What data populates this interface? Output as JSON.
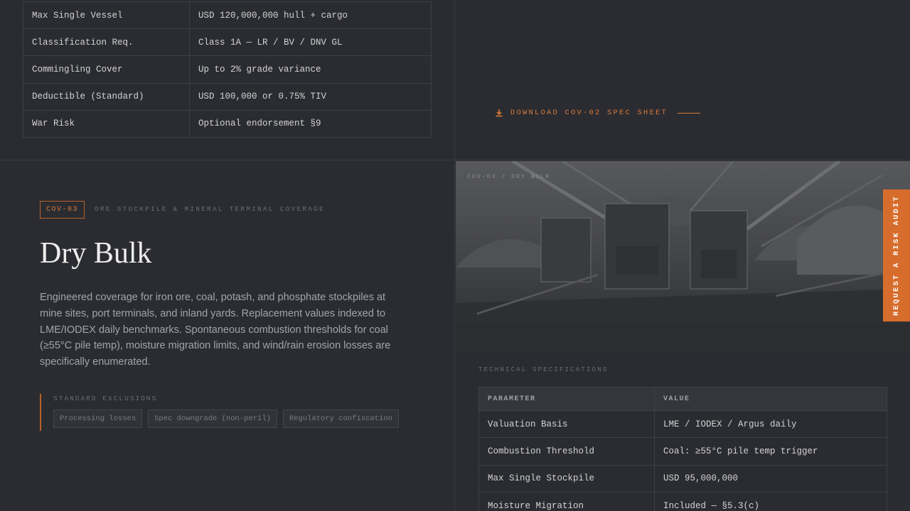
{
  "prev_section": {
    "rows": [
      {
        "param": "Max Single Vessel",
        "value": "USD 120,000,000 hull + cargo"
      },
      {
        "param": "Classification Req.",
        "value": "Class 1A — LR / BV / DNV GL"
      },
      {
        "param": "Commingling Cover",
        "value": "Up to 2% grade variance"
      },
      {
        "param": "Deductible (Standard)",
        "value": "USD 100,000 or 0.75% TIV"
      },
      {
        "param": "War Risk",
        "value": "Optional endorsement §9"
      }
    ],
    "download_label": "DOWNLOAD COV-02 SPEC SHEET",
    "download_icon": "download-arrow-icon"
  },
  "section": {
    "code": "COV-03",
    "kicker": "ORE STOCKPILE & MINERAL TERMINAL COVERAGE",
    "title": "Dry Bulk",
    "description": "Engineered coverage for iron ore, coal, potash, and phosphate stockpiles at mine sites, port terminals, and inland yards. Replacement values indexed to LME/IODEX daily benchmarks. Spontaneous combustion thresholds for coal (≥55°C pile temp), moisture migration limits, and wind/rain erosion losses are specifically enumerated.",
    "exclusions_label": "STANDARD EXCLUSIONS",
    "exclusions": [
      "Processing losses",
      "Spec downgrade (non-peril)",
      "Regulatory confiscation"
    ],
    "photo_tag": "COV-03 / DRY BULK",
    "tech_label": "TECHNICAL SPECIFICATIONS",
    "tech_headers": {
      "param": "PARAMETER",
      "value": "VALUE"
    },
    "tech_rows": [
      {
        "param": "Valuation Basis",
        "value": "LME / IODEX / Argus daily"
      },
      {
        "param": "Combustion Threshold",
        "value": "Coal: ≥55°C pile temp trigger"
      },
      {
        "param": "Max Single Stockpile",
        "value": "USD 95,000,000"
      },
      {
        "param": "Moisture Migration",
        "value": "Included — §5.3(c)"
      }
    ]
  },
  "cta": {
    "label": "REQUEST A RISK AUDIT"
  },
  "colors": {
    "accent": "#d76d2c",
    "background": "#2b2c31",
    "border": "#3f4046"
  }
}
